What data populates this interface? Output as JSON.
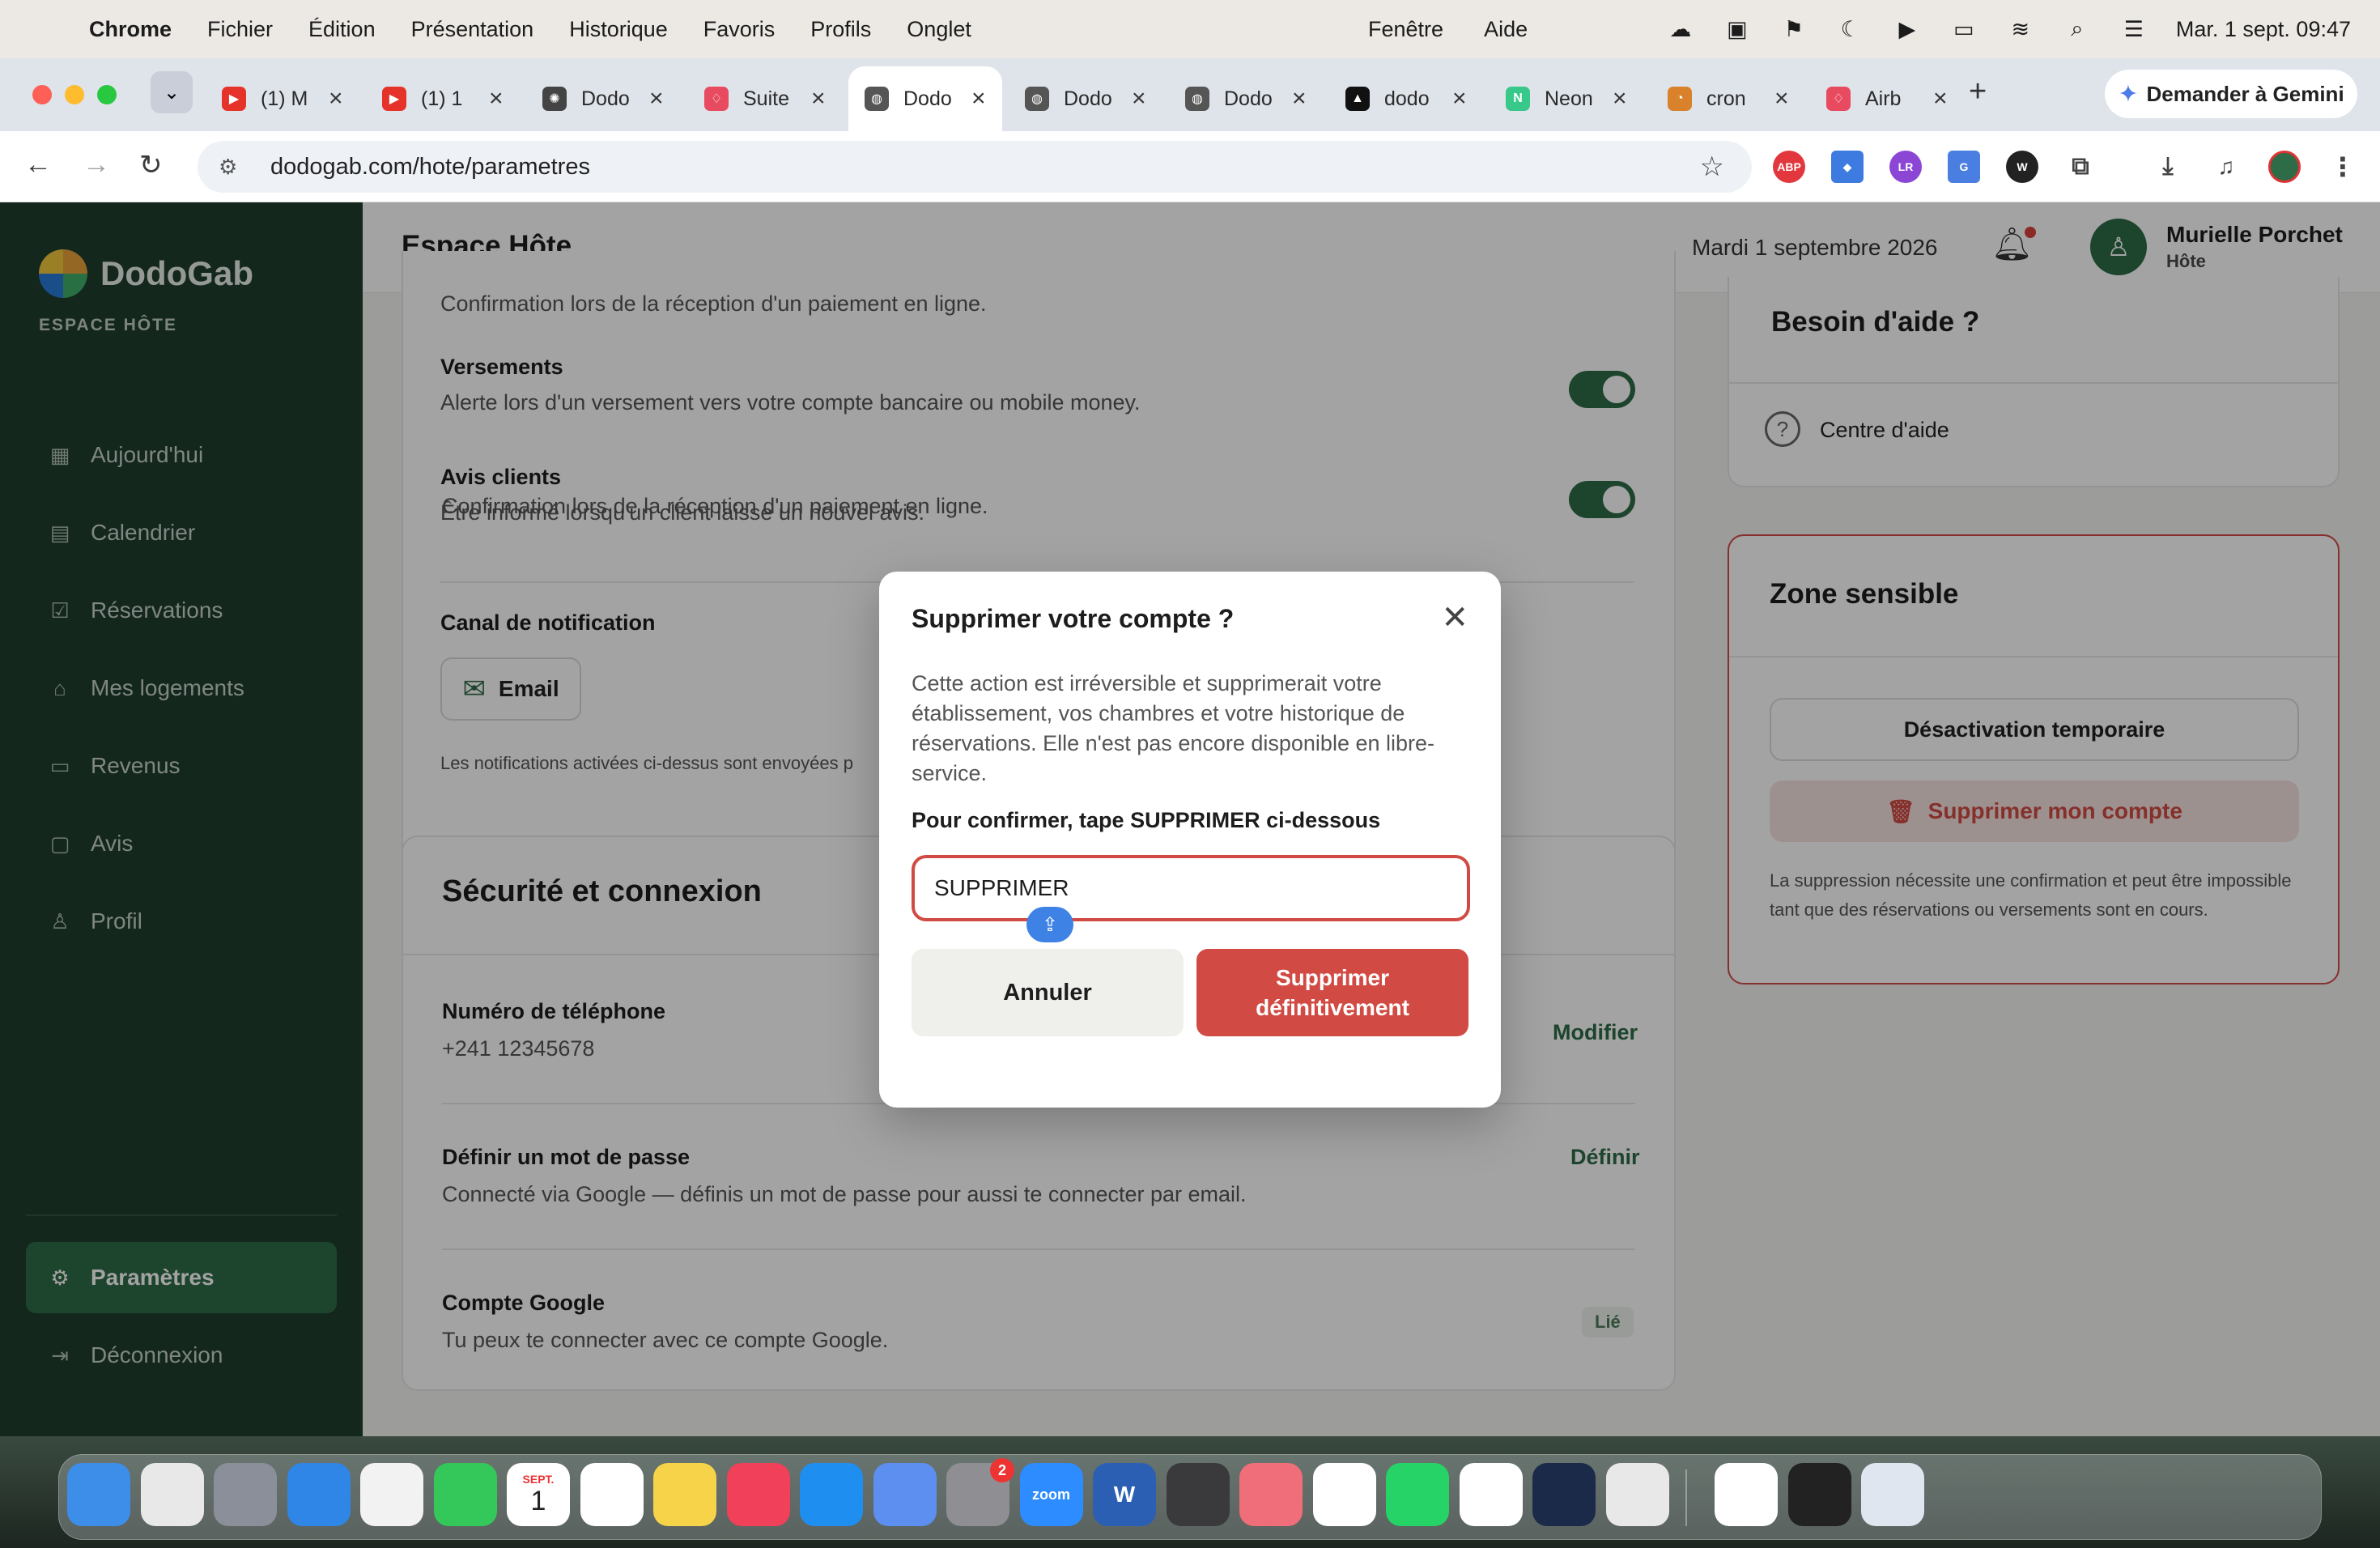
{
  "menubar": {
    "app": "Chrome",
    "items": [
      "Fichier",
      "Édition",
      "Présentation",
      "Historique",
      "Favoris",
      "Profils",
      "Onglet"
    ],
    "right_items": [
      "Fenêtre",
      "Aide"
    ],
    "clock": "Mar. 1 sept. 09:47"
  },
  "tabs": [
    {
      "title": "(1) M",
      "favicon": "youtube-icon",
      "color": "#e5332a"
    },
    {
      "title": "(1) 1",
      "favicon": "youtube-icon",
      "color": "#e5332a"
    },
    {
      "title": "Dodo",
      "favicon": "openai-icon",
      "color": "#444444"
    },
    {
      "title": "Suite",
      "favicon": "airbnb-icon",
      "color": "#e84a5f"
    },
    {
      "title": "Dodo",
      "favicon": "globe-icon",
      "color": "#555555"
    },
    {
      "title": "Dodo",
      "favicon": "globe-icon",
      "color": "#555555"
    },
    {
      "title": "Dodo",
      "favicon": "globe-icon",
      "color": "#555555"
    },
    {
      "title": "dodo",
      "favicon": "vercel-icon",
      "color": "#111111"
    },
    {
      "title": "Neon",
      "favicon": "neon-icon",
      "color": "#38c98a"
    },
    {
      "title": "cron",
      "favicon": "cron-icon",
      "color": "#d9822b"
    },
    {
      "title": "Airb",
      "favicon": "airbnb-icon",
      "color": "#e84a5f"
    }
  ],
  "gemini_label": "Demander à Gemini",
  "url": "dodogab.com/hote/parametres",
  "brand": {
    "name": "DodoGab",
    "sub": "ESPACE HÔTE"
  },
  "sidebar": {
    "items": [
      {
        "label": "Aujourd'hui",
        "icon": "grid-icon"
      },
      {
        "label": "Calendrier",
        "icon": "calendar-icon"
      },
      {
        "label": "Réservations",
        "icon": "calendar-check-icon"
      },
      {
        "label": "Mes logements",
        "icon": "home-icon"
      },
      {
        "label": "Revenus",
        "icon": "wallet-icon"
      },
      {
        "label": "Avis",
        "icon": "message-icon"
      },
      {
        "label": "Profil",
        "icon": "user-icon"
      }
    ],
    "settings": "Paramètres",
    "logout": "Déconnexion"
  },
  "topbar": {
    "title": "Espace Hôte",
    "date": "Mardi 1 septembre 2026",
    "user_name": "Murielle Porchet",
    "user_role": "Hôte"
  },
  "notifications": {
    "payment_desc": "Confirmation lors de la réception d'un paiement en ligne.",
    "payouts_title": "Versements",
    "payouts_desc": "Alerte lors d'un versement vers votre compte bancaire ou mobile money.",
    "payouts_enabled": true,
    "reviews_title": "Avis clients",
    "reviews_desc": "Être informé lorsqu'un client laisse un nouvel avis.",
    "reviews_enabled": true,
    "channel_title": "Canal de notification",
    "channel_email": "Email",
    "channel_note": "Les notifications activées ci-dessus sont envoyées p"
  },
  "security": {
    "title": "Sécurité et connexion",
    "phone_title": "Numéro de téléphone",
    "phone_value": "+241 12345678",
    "phone_action": "Modifier",
    "password_title": "Définir un mot de passe",
    "password_desc": "Connecté via Google — définis un mot de passe pour aussi te connecter par email.",
    "password_action": "Définir",
    "google_title": "Compte Google",
    "google_desc": "Tu peux te connecter avec ce compte Google.",
    "google_badge": "Lié"
  },
  "help": {
    "title": "Besoin d'aide ?",
    "center": "Centre d'aide"
  },
  "danger_zone": {
    "title": "Zone sensible",
    "deactivate": "Désactivation temporaire",
    "delete": "Supprimer mon compte",
    "note": "La suppression nécessite une confirmation et peut être impossible tant que des réservations ou versements sont en cours."
  },
  "modal": {
    "title": "Supprimer votre compte ?",
    "body": "Cette action est irréversible et supprimerait votre établissement, vos chambres et votre historique de réservations. Elle n'est pas encore disponible en libre-service.",
    "label_prefix": "Pour confirmer, tape ",
    "label_keyword": "SUPPRIMER",
    "label_suffix": " ci-dessous",
    "input_value": "SUPPRIMER",
    "cancel": "Annuler",
    "confirm": "Supprimer définitivement",
    "accent": "#d14b44"
  },
  "dock": [
    {
      "name": "finder-icon",
      "color": "#3d8ee8"
    },
    {
      "name": "chrome-icon",
      "color": "#e8e8e8"
    },
    {
      "name": "launchpad-icon",
      "color": "#8a8f99"
    },
    {
      "name": "safari-icon",
      "color": "#2f86e6"
    },
    {
      "name": "photos-icon",
      "color": "#f2f2f2"
    },
    {
      "name": "facetime-icon",
      "color": "#34c759"
    },
    {
      "name": "calendar-app-icon",
      "color": "#ffffff"
    },
    {
      "name": "reminders-icon",
      "color": "#ffffff"
    },
    {
      "name": "notes-icon",
      "color": "#f7d34a"
    },
    {
      "name": "music-icon",
      "color": "#f0405a"
    },
    {
      "name": "app-store-icon",
      "color": "#1f8ef1"
    },
    {
      "name": "ai-app-icon",
      "color": "#5d8ff0"
    },
    {
      "name": "system-settings-icon",
      "color": "#8e8e93"
    },
    {
      "name": "zoom-icon",
      "color": "#2d8cff"
    },
    {
      "name": "word-icon",
      "color": "#2b5fb4"
    },
    {
      "name": "calculator-icon",
      "color": "#3a3a3c"
    },
    {
      "name": "tasks-icon",
      "color": "#f06e7a"
    },
    {
      "name": "capcut-icon",
      "color": "#ffffff"
    },
    {
      "name": "whatsapp-icon",
      "color": "#25d366"
    },
    {
      "name": "drive-icon",
      "color": "#ffffff"
    },
    {
      "name": "affinity-icon",
      "color": "#1c2a4a"
    },
    {
      "name": "iphone-mirroring-icon",
      "color": "#e8e8e8"
    },
    {
      "name": "proton-vpn-icon",
      "color": "#ffffff"
    },
    {
      "name": "terminal-icon",
      "color": "#222222"
    },
    {
      "name": "preview-icon",
      "color": "#dfe6ef"
    }
  ],
  "dock_badge": "2",
  "dock_labels": {
    "calendar_month": "SEPT.",
    "calendar_day": "1",
    "zoom": "zoom",
    "word": "W"
  }
}
